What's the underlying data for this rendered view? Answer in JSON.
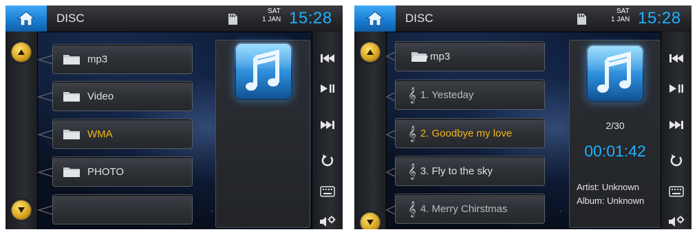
{
  "left": {
    "title": "DISC",
    "day": "SAT",
    "date": "1 JAN",
    "time": "15:28",
    "items": [
      {
        "label": "mp3"
      },
      {
        "label": "Video"
      },
      {
        "label": "WMA"
      },
      {
        "label": "PHOTO"
      },
      {
        "label": ""
      }
    ]
  },
  "right": {
    "title": "DISC",
    "day": "SAT",
    "date": "1 JAN",
    "time": "15:28",
    "folder": "mp3",
    "tracks": [
      {
        "label": "1. Yesteday"
      },
      {
        "label": "2. Goodbye my love"
      },
      {
        "label": "3. Fly to the sky"
      },
      {
        "label": "4. Merry Chirstmas"
      }
    ],
    "track_count": "2/30",
    "elapsed": "00:01:42",
    "artist": "Artist: Unknown",
    "album": "Album: Unknown"
  },
  "colors": {
    "accent_blue": "#1fb0ff",
    "active_yellow": "#f2b619",
    "home_blue": "#1b7fd4"
  },
  "icons": [
    "home-icon",
    "sd-card-icon",
    "folder-icon",
    "music-note-icon",
    "treble-clef-icon",
    "prev-track-icon",
    "play-pause-icon",
    "next-track-icon",
    "repeat-icon",
    "keyboard-icon",
    "sound-settings-icon",
    "up-arrow-icon",
    "down-arrow-icon"
  ]
}
